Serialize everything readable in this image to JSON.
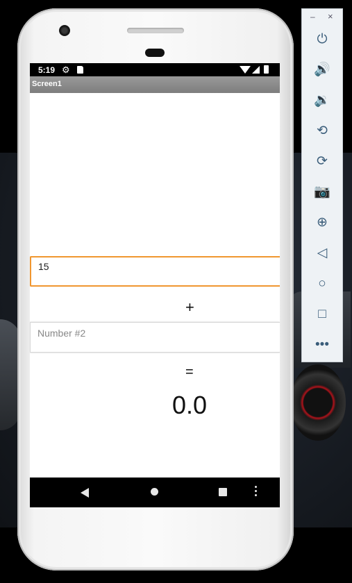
{
  "status_bar": {
    "time": "5:19"
  },
  "app": {
    "title": "Screen1"
  },
  "calculator": {
    "number1_value": "15",
    "number1_placeholder": "",
    "number2_value": "",
    "number2_placeholder": "Number #2",
    "operator": "+",
    "equals": "=",
    "result": "0.0"
  },
  "window_controls": {
    "minimize": "–",
    "close": "×"
  },
  "emulator_toolbar": {
    "icons": [
      "power-icon",
      "volume-up-icon",
      "volume-down-icon",
      "rotate-left-icon",
      "rotate-right-icon",
      "camera-icon",
      "zoom-icon",
      "back-icon",
      "home-icon",
      "overview-icon",
      "more-icon"
    ]
  },
  "colors": {
    "focus_border": "#f0962f",
    "titlebar": "#8a8a8a",
    "toolbar_icon": "#3a5d7a"
  }
}
